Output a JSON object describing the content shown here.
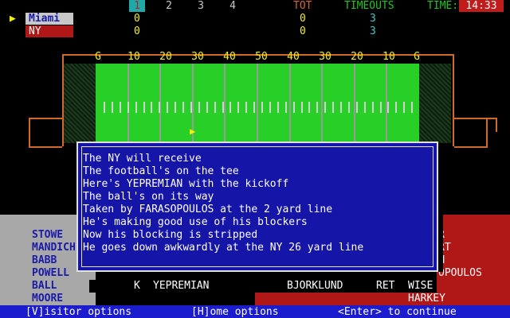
{
  "scoreboard": {
    "quarters": [
      "1",
      "2",
      "3",
      "4"
    ],
    "active_quarter_index": 0,
    "tot_label": "TOT",
    "timeouts_label": "TIMEOUTS",
    "time_label": "TIME:",
    "clock": "14:33",
    "possession_marker": "▶",
    "teams": [
      {
        "name": "Miami",
        "q1": "0",
        "tot": "0",
        "timeouts": "3"
      },
      {
        "name": "NY",
        "q1": "0",
        "tot": "0",
        "timeouts": "3"
      }
    ]
  },
  "field": {
    "yard_labels": [
      "G",
      "10",
      "20",
      "30",
      "40",
      "50",
      "40",
      "30",
      "20",
      "10",
      "G"
    ],
    "ball_marker": "▶"
  },
  "dialog": {
    "lines": [
      "The NY will receive",
      "The football's on the tee",
      "Here's YEPREMIAN with the kickoff",
      "The ball's on its way",
      "Taken by FARASOPOULOS at the 2 yard line",
      "He's making good use of his blockers",
      "Now his blocking is stripped",
      "He goes down awkwardly at the NY 26 yard line"
    ]
  },
  "rosters": {
    "visitor_players": [
      "STOWE",
      "MANDICH",
      "BABB",
      "POWELL",
      "BALL",
      "MOORE"
    ],
    "home_players_partial": [
      "R",
      "RT",
      "M",
      "OPOULOS"
    ],
    "kick_row": {
      "k_label": "K",
      "kicker": "YEPREMIAN",
      "returner_blocker": "BJORKLUND",
      "ret_label": "RET",
      "returner": "WISE"
    },
    "home_bottom": "HARKEY"
  },
  "bottom_bar": {
    "visitor_options": "[V]isitor options",
    "home_options": "[H]ome options",
    "continue": "<Enter> to continue"
  },
  "colors": {
    "field": "#27cf27",
    "dialog_bg": "#1515a8",
    "bottom_bar": "#1c1ccf",
    "home_team": "#b01818",
    "visitor_team": "#a8a8a8"
  }
}
